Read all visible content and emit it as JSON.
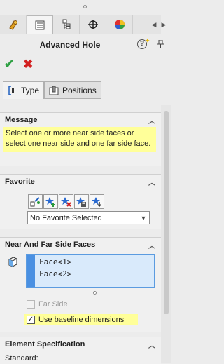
{
  "window": {
    "title": "Advanced Hole"
  },
  "tabs": [
    {
      "name": "feature-manager",
      "active": false
    },
    {
      "name": "property-manager",
      "active": true
    },
    {
      "name": "configuration-manager",
      "active": false
    },
    {
      "name": "dimxpert-manager",
      "active": false
    },
    {
      "name": "display-manager",
      "active": false
    }
  ],
  "actions": {
    "ok_icon": "check-icon",
    "cancel_icon": "x-icon"
  },
  "subtabs": {
    "type_label": "Type",
    "positions_label": "Positions"
  },
  "message_panel": {
    "heading": "Message",
    "text": "Select one or more near side faces or select one near side and one far side face."
  },
  "favorite_panel": {
    "heading": "Favorite",
    "select_value": "No Favorite Selected"
  },
  "faces_panel": {
    "heading": "Near And Far Side Faces",
    "faces": [
      "Face<1>",
      "Face<2>"
    ],
    "far_side_label": "Far Side",
    "far_side_checked": false,
    "baseline_label": "Use baseline dimensions",
    "baseline_checked": true
  },
  "element_panel": {
    "heading": "Element Specification",
    "standard_label": "Standard:"
  },
  "colors": {
    "highlight": "#ffff99",
    "selection_blue": "#4a90e2",
    "ok_green": "#2ea043",
    "cancel_red": "#d32020"
  }
}
